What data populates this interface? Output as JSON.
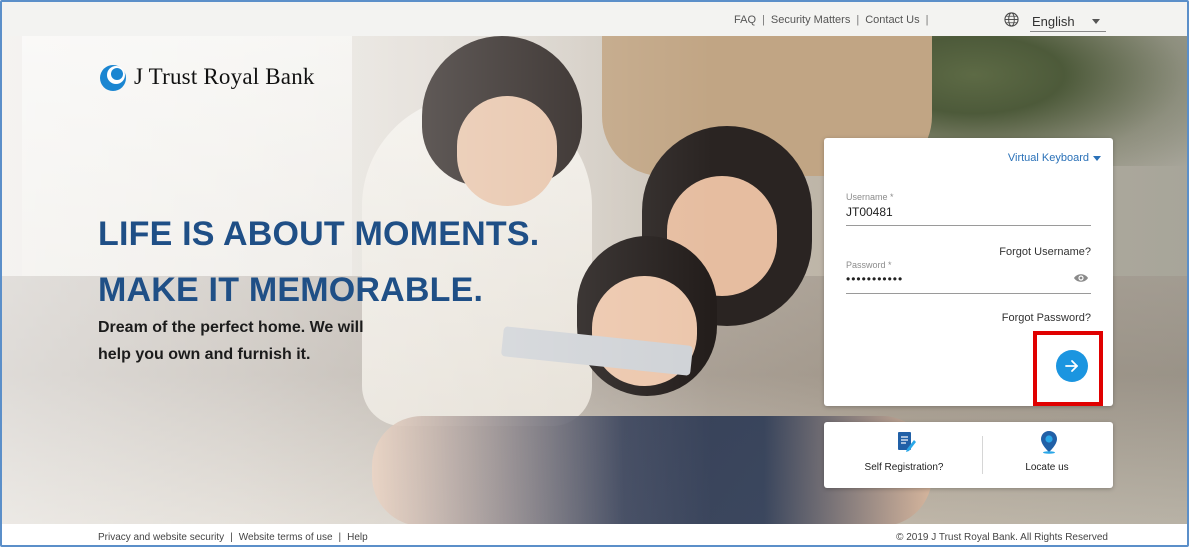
{
  "topbar": {
    "links": [
      "FAQ",
      "Security Matters",
      "Contact Us"
    ],
    "language": "English"
  },
  "brand": {
    "name": "J Trust Royal Bank"
  },
  "hero": {
    "headline_line1": "LIFE IS ABOUT MOMENTS.",
    "headline_line2": "MAKE IT MEMORABLE.",
    "tagline_line1": "Dream of the perfect home. We will",
    "tagline_line2": "help you own and furnish it."
  },
  "login": {
    "virtual_keyboard_label": "Virtual Keyboard",
    "username_label": "Username *",
    "username_value": "JT00481",
    "forgot_username": "Forgot Username?",
    "password_label": "Password *",
    "password_value": "•••••••••••",
    "forgot_password": "Forgot Password?"
  },
  "quick_links": {
    "self_registration": "Self Registration?",
    "locate_us": "Locate us"
  },
  "footer": {
    "links": [
      "Privacy and website security",
      "Website terms of use",
      "Help"
    ],
    "copyright": "© 2019 J Trust Royal Bank. All Rights Reserved"
  },
  "colors": {
    "headline": "#1f4f86",
    "accent": "#1b95e0",
    "link": "#2a71b8",
    "highlight_border": "#e00000"
  },
  "icons": [
    "globe-icon",
    "logo-mark-icon",
    "chevron-down-icon",
    "eye-icon",
    "arrow-right-icon",
    "registration-icon",
    "location-pin-icon"
  ]
}
